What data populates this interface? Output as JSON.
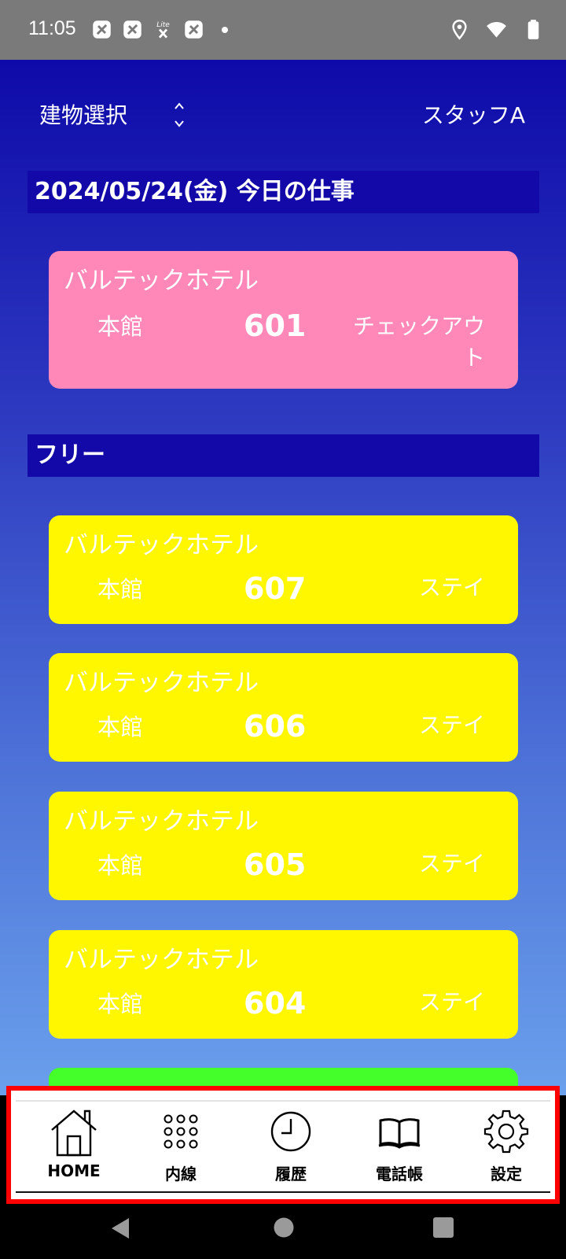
{
  "status_bar": {
    "time": "11:05",
    "lite_label": "Lite"
  },
  "header": {
    "building_select_label": "建物選択",
    "staff_name": "スタッフA"
  },
  "sections": [
    {
      "title": "2024/05/24(金) 今日の仕事"
    },
    {
      "title": "フリー"
    }
  ],
  "cards": [
    {
      "hotel": "バルテックホテル",
      "building": "本館",
      "room": "601",
      "status": "チェックアウト",
      "color": "#ff88b8"
    },
    {
      "hotel": "バルテックホテル",
      "building": "本館",
      "room": "607",
      "status": "ステイ",
      "color": "#fff700"
    },
    {
      "hotel": "バルテックホテル",
      "building": "本館",
      "room": "606",
      "status": "ステイ",
      "color": "#fff700"
    },
    {
      "hotel": "バルテックホテル",
      "building": "本館",
      "room": "605",
      "status": "ステイ",
      "color": "#fff700"
    },
    {
      "hotel": "バルテックホテル",
      "building": "本館",
      "room": "604",
      "status": "ステイ",
      "color": "#fff700"
    },
    {
      "color": "#44ff2a"
    }
  ],
  "bottom_nav": {
    "items": [
      {
        "label": "HOME",
        "icon": "home-icon"
      },
      {
        "label": "内線",
        "icon": "dialpad-icon"
      },
      {
        "label": "履歴",
        "icon": "clock-icon"
      },
      {
        "label": "電話帳",
        "icon": "book-icon"
      },
      {
        "label": "設定",
        "icon": "gear-icon"
      }
    ]
  },
  "colors": {
    "header_bar": "#1209a8",
    "highlight_border": "#ff0000"
  }
}
